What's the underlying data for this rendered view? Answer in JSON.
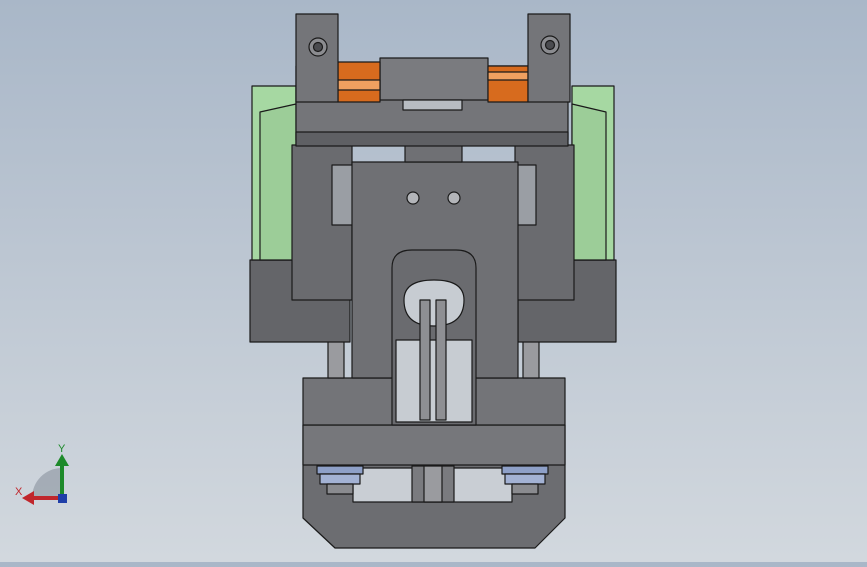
{
  "viewport": {
    "model": "gripper-assembly-front-view",
    "colors": {
      "background_top": "#a9b7c8",
      "background_bottom": "#d2d8de",
      "steel": "#6f7074",
      "steel_dark": "#4a4b4f",
      "steel_light": "#8b8c90",
      "pad_green": "#a6d8a2",
      "pad_green_dark": "#7fb07c",
      "copper": "#d76b1e",
      "copper_light": "#f0a060",
      "bolt_blue": "#8ea0c8",
      "outline": "#1a1a1a"
    }
  },
  "triad": {
    "x_label": "X",
    "y_label": "Y",
    "x_color": "#c0262c",
    "y_color": "#1d8a2a",
    "z_color": "#1f3ea8"
  }
}
